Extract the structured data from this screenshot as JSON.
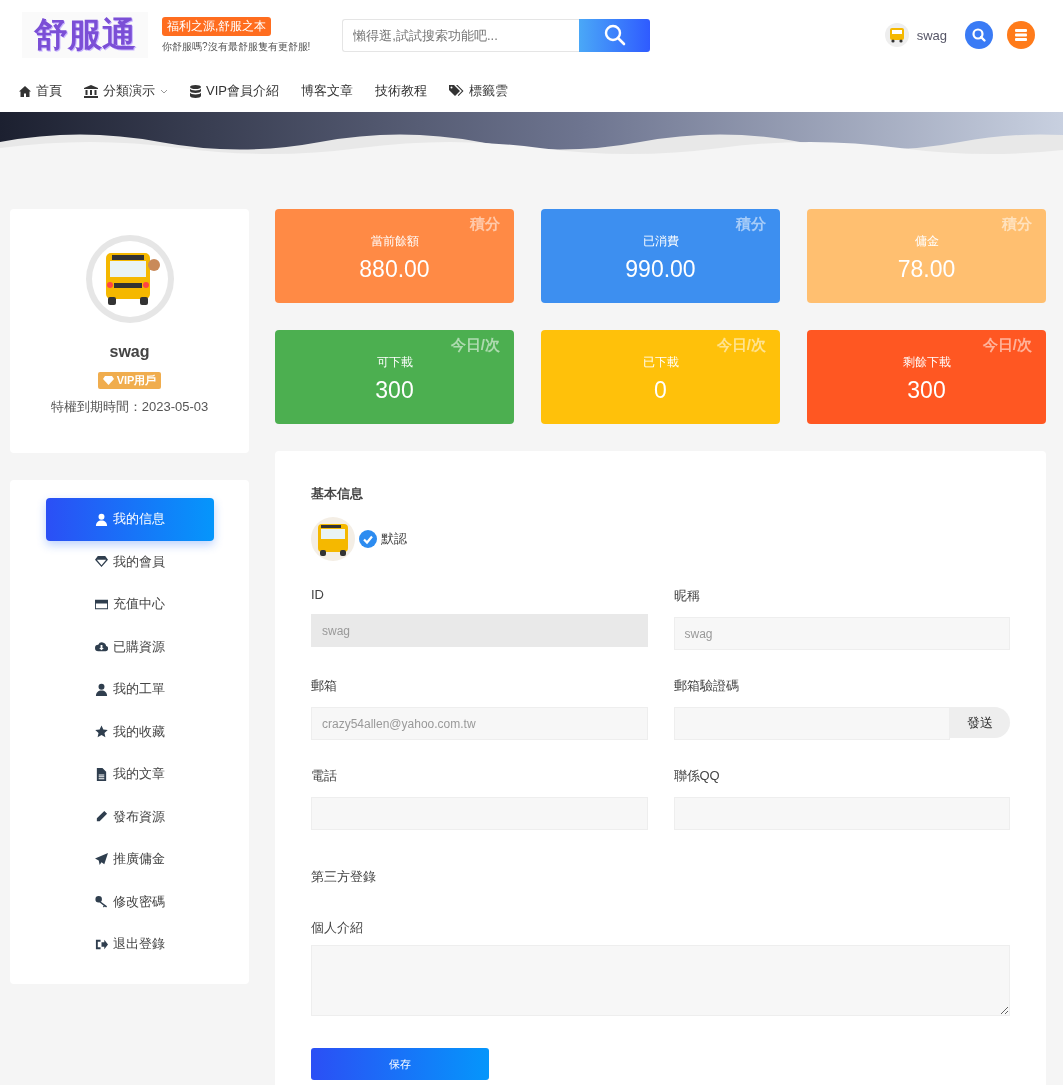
{
  "header": {
    "logo": "舒服通",
    "slogan": "福利之源,舒服之本",
    "tagline": "你舒服嗎?沒有最舒服隻有更舒服!",
    "search": {
      "placeholder": "懶得逛,試試搜索功能吧..."
    },
    "user": "swag"
  },
  "nav": [
    {
      "label": "首頁",
      "dropdown": false
    },
    {
      "label": "分類演示",
      "dropdown": true
    },
    {
      "label": "VIP會員介紹",
      "dropdown": false
    },
    {
      "label": "博客文章",
      "dropdown": false
    },
    {
      "label": "技術教程",
      "dropdown": false
    },
    {
      "label": "標籤雲",
      "dropdown": false
    }
  ],
  "profile": {
    "name": "swag",
    "badge": "VIP用戶",
    "expiry": "特權到期時間：2023-05-03"
  },
  "stats": [
    {
      "label": "當前餘額",
      "value": "880.00",
      "unit": "積分",
      "color": "#ff8a45"
    },
    {
      "label": "已消費",
      "value": "990.00",
      "unit": "積分",
      "color": "#3d8ff0"
    },
    {
      "label": "傭金",
      "value": "78.00",
      "unit": "積分",
      "color": "#ffbf70"
    },
    {
      "label": "可下載",
      "value": "300",
      "unit": "今日/次",
      "color": "#4caf50"
    },
    {
      "label": "已下載",
      "value": "0",
      "unit": "今日/次",
      "color": "#ffc10a"
    },
    {
      "label": "剩餘下載",
      "value": "300",
      "unit": "今日/次",
      "color": "#ff5722"
    }
  ],
  "menu": [
    {
      "label": "我的信息",
      "selected": true
    },
    {
      "label": "我的會員",
      "selected": false
    },
    {
      "label": "充值中心",
      "selected": false
    },
    {
      "label": "已購資源",
      "selected": false
    },
    {
      "label": "我的工單",
      "selected": false
    },
    {
      "label": "我的收藏",
      "selected": false
    },
    {
      "label": "我的文章",
      "selected": false
    },
    {
      "label": "發布資源",
      "selected": false
    },
    {
      "label": "推廣傭金",
      "selected": false
    },
    {
      "label": "修改密碼",
      "selected": false
    },
    {
      "label": "退出登錄",
      "selected": false
    }
  ],
  "form": {
    "title": "基本信息",
    "avatar_label": "默認",
    "fields": [
      {
        "kind": "input",
        "label": "ID",
        "value": "swag",
        "disabled": true
      },
      {
        "kind": "input",
        "label": "昵稱",
        "value": "swag",
        "disabled": false
      },
      {
        "kind": "input",
        "label": "郵箱",
        "value": "crazy54allen@yahoo.com.tw",
        "disabled": false
      },
      {
        "kind": "code",
        "label": "郵箱驗證碼",
        "button": "發送",
        "disabled": false
      },
      {
        "kind": "input",
        "label": "電話",
        "disabled": false
      },
      {
        "kind": "input",
        "label": "聯係QQ",
        "disabled": false
      }
    ],
    "third_party": "第三方登錄",
    "bio_label": "個人介紹",
    "save": "保存"
  }
}
